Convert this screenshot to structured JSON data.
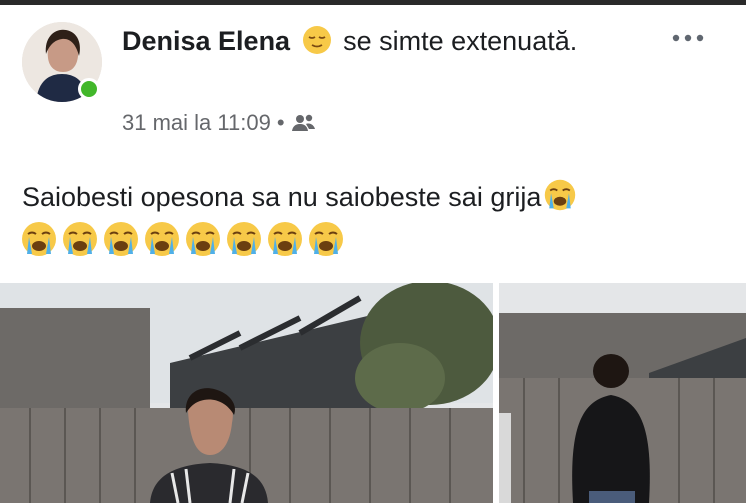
{
  "post": {
    "author_name": "Denisa Elena",
    "feeling_text": "se simte extenuată.",
    "timestamp": "31 mai la 11:09",
    "separator": "•",
    "audience_icon": "friends-icon",
    "feeling_icon": "relieved-face-icon",
    "more_icon": "more-options-icon",
    "body_text": "Saiobesti opesona sa nu saiobeste sai grija",
    "trailing_emoji": "loudly-crying-face-icon",
    "emoji_row_count": 8,
    "emoji_row_icon": "loudly-crying-face-icon",
    "online_status_color": "#42b72a"
  },
  "photos": [
    {
      "name": "photo-front",
      "description_icon": "photo-icon"
    },
    {
      "name": "photo-back",
      "description_icon": "photo-icon"
    }
  ]
}
